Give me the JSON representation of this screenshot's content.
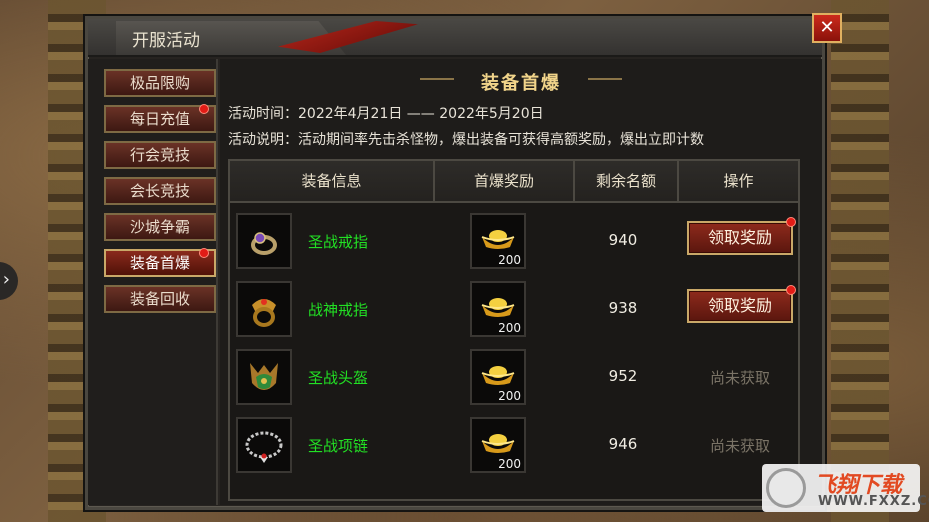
{
  "window": {
    "title": "开服活动",
    "close_glyph": "✕"
  },
  "sidebar": {
    "items": [
      {
        "label": "极品限购",
        "active": false,
        "badge": false
      },
      {
        "label": "每日充值",
        "active": false,
        "badge": true
      },
      {
        "label": "行会竞技",
        "active": false,
        "badge": false
      },
      {
        "label": "会长竞技",
        "active": false,
        "badge": false
      },
      {
        "label": "沙城争霸",
        "active": false,
        "badge": false
      },
      {
        "label": "装备首爆",
        "active": true,
        "badge": true
      },
      {
        "label": "装备回收",
        "active": false,
        "badge": false
      }
    ]
  },
  "main": {
    "section_title": "装备首爆",
    "time_line": "活动时间：2022年4月21日 —— 2022年5月20日",
    "desc_line": "活动说明：活动期间率先击杀怪物，爆出装备可获得高额奖励，爆出立即计数",
    "table": {
      "headers": [
        "装备信息",
        "首爆奖励",
        "剩余名额",
        "操作"
      ],
      "rows": [
        {
          "name": "圣战戒指",
          "icon": "ring-icon",
          "reward_qty": "200",
          "remaining": "940",
          "action": "领取奖励",
          "claimable": true
        },
        {
          "name": "战神戒指",
          "icon": "ring-icon",
          "reward_qty": "200",
          "remaining": "938",
          "action": "领取奖励",
          "claimable": true
        },
        {
          "name": "圣战头盔",
          "icon": "helmet-icon",
          "reward_qty": "200",
          "remaining": "952",
          "action": "尚未获取",
          "claimable": false
        },
        {
          "name": "圣战项链",
          "icon": "necklace-icon",
          "reward_qty": "200",
          "remaining": "946",
          "action": "尚未获取",
          "claimable": false
        }
      ]
    }
  },
  "side_arrow": "›",
  "watermark": {
    "line1": "飞翔下载",
    "line2": "WWW.FXXZ.COM"
  },
  "colors": {
    "item_name": "#22e024",
    "section_title": "#f1d48a",
    "badge": "#e21c16"
  }
}
